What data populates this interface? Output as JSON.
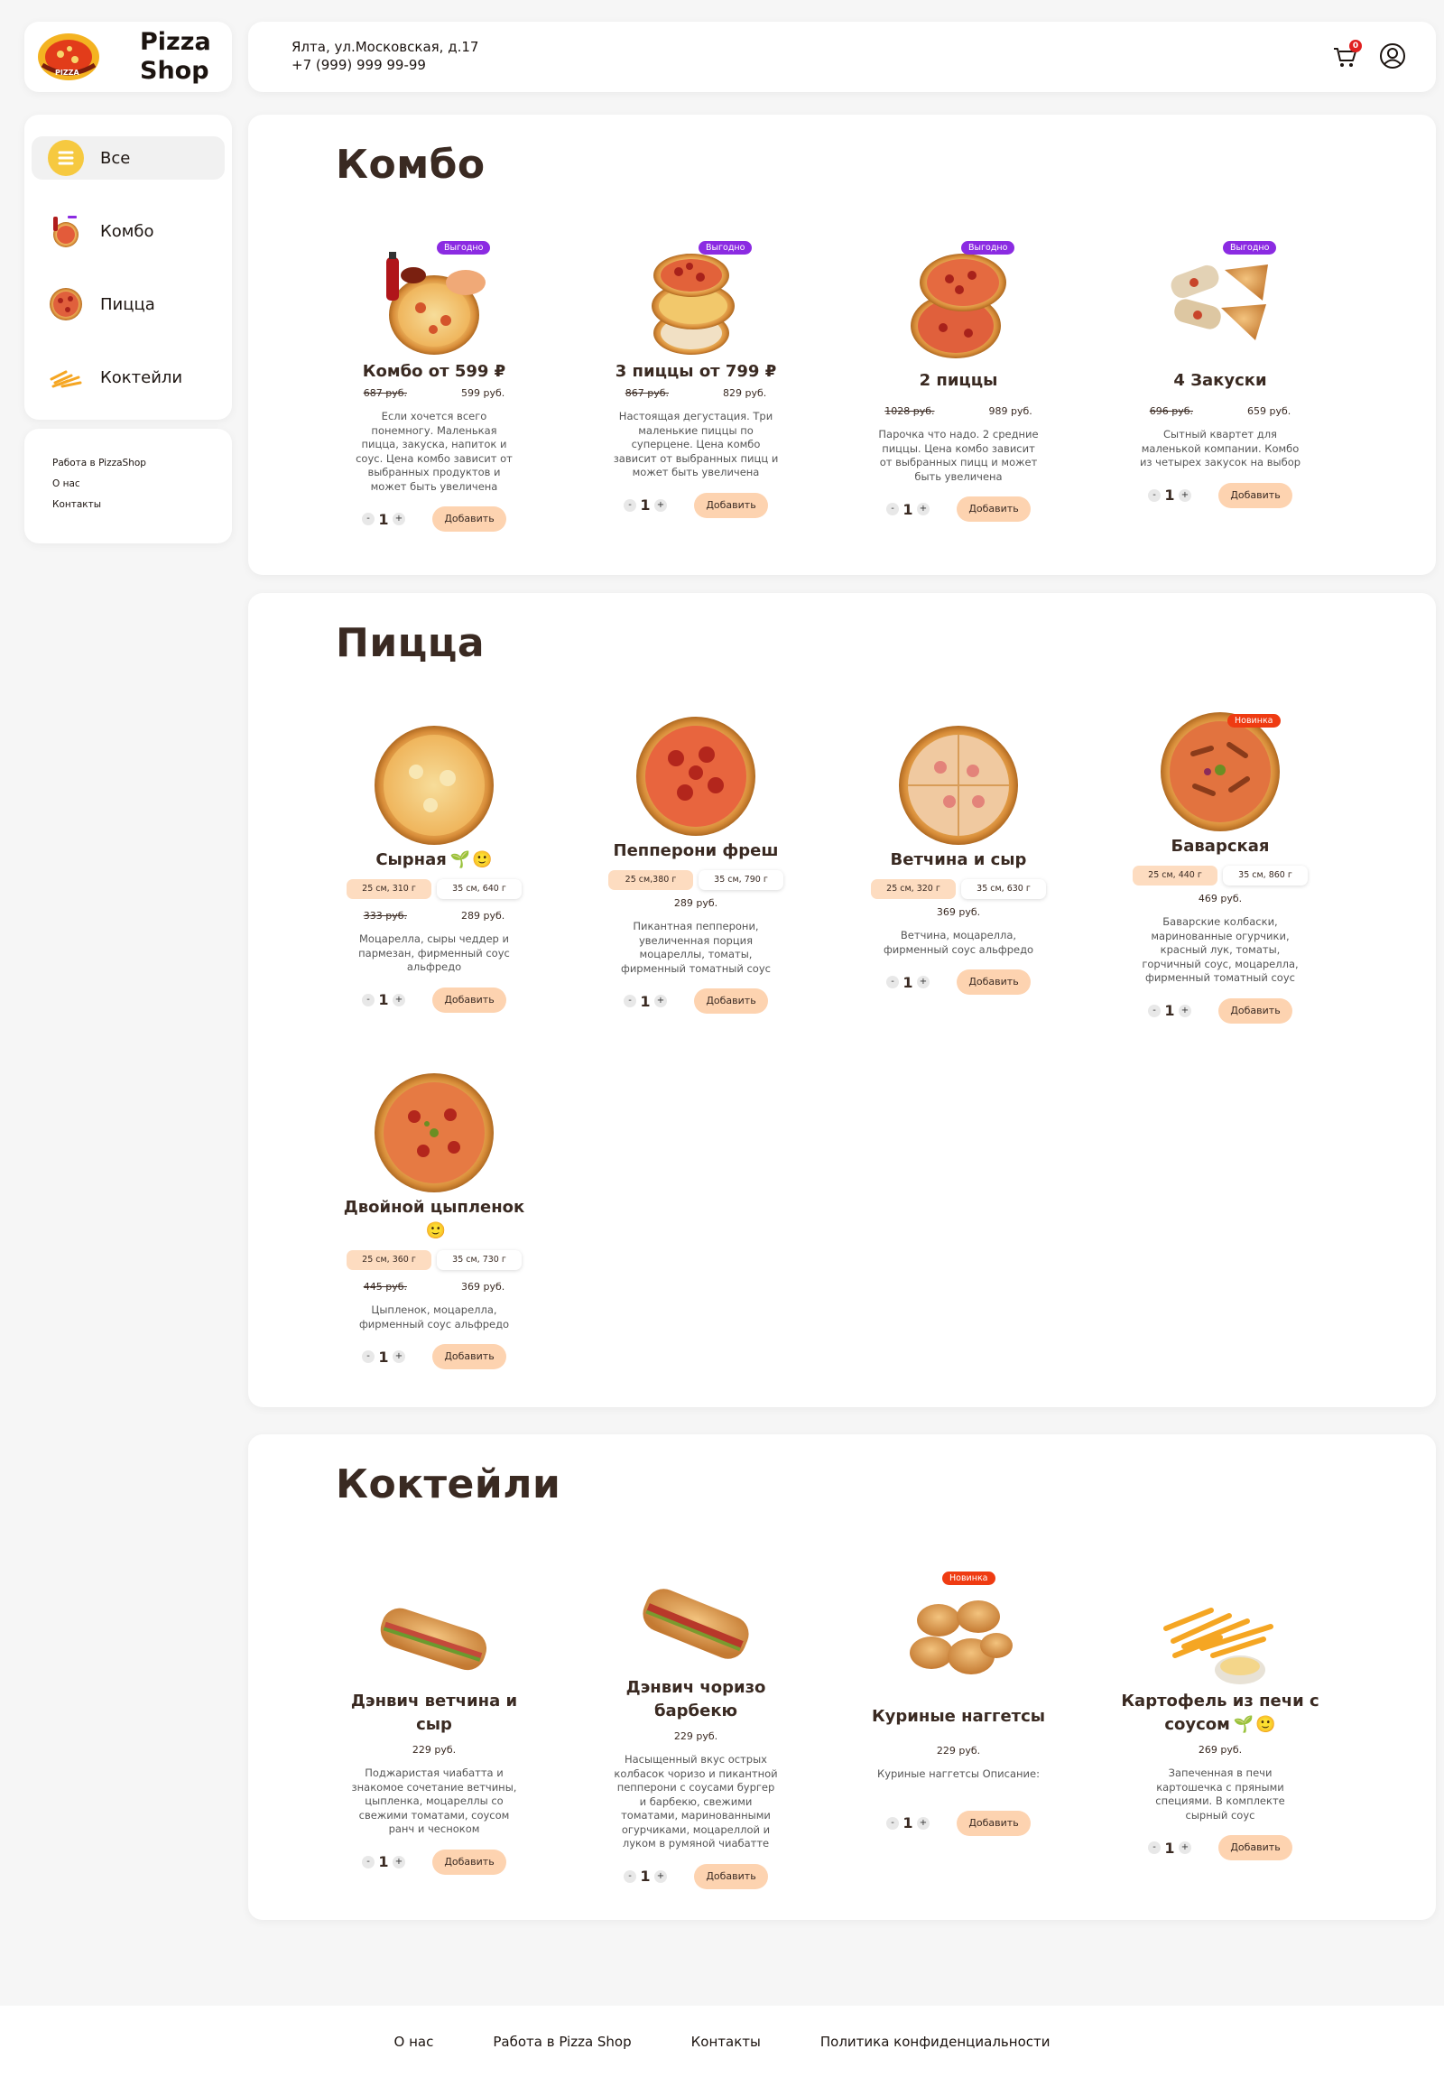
{
  "brand": {
    "name_line1": "Pizza",
    "name_line2": "Shop",
    "logo_text": "PIZZA"
  },
  "header": {
    "address": "Ялта, ул.Московская, д.17",
    "phone": "+7 (999) 999 99-99",
    "cart_count": "0"
  },
  "nav": {
    "items": [
      {
        "label": "Все"
      },
      {
        "label": "Комбо"
      },
      {
        "label": "Пицца"
      },
      {
        "label": "Коктейли"
      }
    ]
  },
  "side_links": [
    "Работа в PizzaShop",
    "О нас",
    "Контакты"
  ],
  "badges": {
    "promo": "Выгодно",
    "new": "Новинка"
  },
  "actions": {
    "qty": "1",
    "add": "Добавить",
    "minus": "-",
    "plus": "+"
  },
  "combo": {
    "title": "Комбо",
    "items": [
      {
        "name": "Комбо от 599 ₽",
        "old_price": "687 руб.",
        "price": "599 руб.",
        "desc": "Если хочется всего понемногу. Маленькая пицца, закуска, напиток и соус. Цена комбо зависит от выбранных продуктов и может быть увеличена"
      },
      {
        "name": "3 пиццы от 799 ₽",
        "old_price": "867 руб.",
        "price": "829 руб.",
        "desc": "Настоящая дегустация. Три маленькие пиццы по суперцене. Цена комбо зависит от выбранных пицц и может быть увеличена"
      },
      {
        "name": "2 пиццы",
        "old_price": "1028 руб.",
        "price": "989 руб.",
        "desc": "Парочка что надо. 2 средние пиццы. Цена комбо зависит от выбранных пицц и может быть увеличена"
      },
      {
        "name": "4 Закуски",
        "old_price": "696 руб.",
        "price": "659 руб.",
        "desc": "Сытный квартет для маленькой компании. Комбо из четырех закусок на выбор"
      }
    ]
  },
  "pizza": {
    "title": "Пицца",
    "items": [
      {
        "name": "Сырная",
        "size1": "25 см, 310 г",
        "size2": "35 см, 640 г",
        "old_price": "333 руб.",
        "price": "289 руб.",
        "desc": "Моцарелла, сыры чеддер и пармезан, фирменный соус альфредо"
      },
      {
        "name": "Пепперони фреш",
        "size1": "25 см,380 г",
        "size2": "35 см, 790 г",
        "price": "289 руб.",
        "desc": "Пикантная пепперони, увеличенная порция моцареллы, томаты, фирменный томатный соус"
      },
      {
        "name": "Ветчина и сыр",
        "size1": "25 см, 320 г",
        "size2": "35 см, 630 г",
        "price": "369 руб.",
        "desc": "Ветчина, моцарелла, фирменный соус альфредо"
      },
      {
        "name": "Баварская",
        "size1": "25 см, 440 г",
        "size2": "35 см, 860 г",
        "price": "469 руб.",
        "desc": "Баварские колбаски, маринованные огурчики, красный лук, томаты, горчичный соус, моцарелла, фирменный томатный соус"
      },
      {
        "name": "Двойной цыпленок",
        "size1": "25 см, 360 г",
        "size2": "35 см, 730 г",
        "old_price": "445 руб.",
        "price": "369 руб.",
        "desc": "Цыпленок, моцарелла, фирменный соус альфредо"
      }
    ]
  },
  "cocktails": {
    "title": "Коктейли",
    "items": [
      {
        "name": "Дэнвич ветчина и сыр",
        "price": "229 руб.",
        "desc": "Поджаристая чиабатта и знакомое сочетание ветчины, цыпленка, моцареллы со свежими томатами, соусом ранч и чесноком"
      },
      {
        "name": "Дэнвич чоризо барбекю",
        "price": "229 руб.",
        "desc": "Насыщенный вкус острых колбасок чоризо и пикантной пепперони с соусами бургер и барбекю, свежими томатами, маринованными огурчиками, моцареллой и луком в румяной чиабатте"
      },
      {
        "name": "Куриные наггетсы",
        "price": "229 руб.",
        "desc": "Куриные наггетсы Описание:"
      },
      {
        "name_line1": "Картофель из печи с",
        "name_line2": "соусом",
        "price": "269 руб.",
        "desc": "Запеченная в печи картошечка с пряными специями. В комплекте сырный соус"
      }
    ]
  },
  "footer": {
    "links": [
      "О нас",
      "Работа в Pizza Shop",
      "Контакты",
      "Политика конфиденциальности"
    ]
  },
  "colors": {
    "accent": "#fdd3b0",
    "size_selected": "#fddcc0",
    "promo": "#8b2be2",
    "new": "#ef3b12",
    "title": "#3a2a22"
  }
}
